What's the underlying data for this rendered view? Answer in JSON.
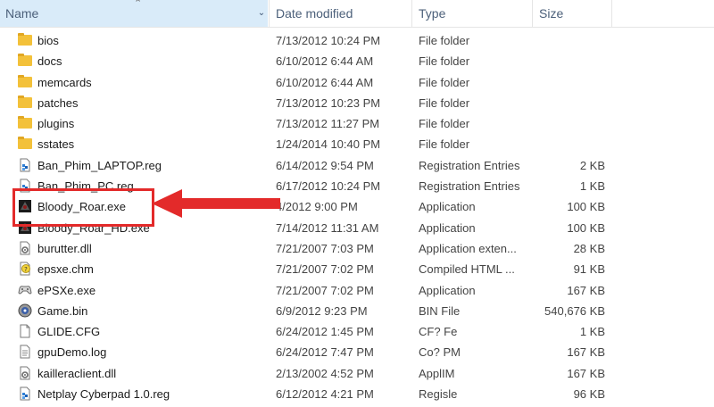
{
  "header": {
    "name": "Name",
    "date_modified": "Date modified",
    "type": "Type",
    "size": "Size"
  },
  "rows": [
    {
      "name": "bios",
      "date": "7/13/2012 10:24 PM",
      "type": "File folder",
      "size": "",
      "icon": "folder-icon"
    },
    {
      "name": "docs",
      "date": "6/10/2012 6:44 AM",
      "type": "File folder",
      "size": "",
      "icon": "folder-icon"
    },
    {
      "name": "memcards",
      "date": "6/10/2012 6:44 AM",
      "type": "File folder",
      "size": "",
      "icon": "folder-icon"
    },
    {
      "name": "patches",
      "date": "7/13/2012 10:23 PM",
      "type": "File folder",
      "size": "",
      "icon": "folder-icon"
    },
    {
      "name": "plugins",
      "date": "7/13/2012 11:27 PM",
      "type": "File folder",
      "size": "",
      "icon": "folder-icon"
    },
    {
      "name": "sstates",
      "date": "1/24/2014 10:40 PM",
      "type": "File folder",
      "size": "",
      "icon": "folder-icon"
    },
    {
      "name": "Ban_Phim_LAPTOP.reg",
      "date": "6/14/2012 9:54 PM",
      "type": "Registration Entries",
      "size": "2 KB",
      "icon": "registry-file-icon"
    },
    {
      "name": "Ban_Phim_PC.reg",
      "date": "6/17/2012 10:24 PM",
      "type": "Registration Entries",
      "size": "1 KB",
      "icon": "registry-file-icon"
    },
    {
      "name": "Bloody_Roar.exe",
      "date": "4/2012 9:00 PM",
      "type": "Application",
      "size": "100 KB",
      "icon": "game-exe-icon"
    },
    {
      "name": "Bloody_Roar_HD.exe",
      "date": "7/14/2012 11:31 AM",
      "type": "Application",
      "size": "100 KB",
      "icon": "game-exe-icon"
    },
    {
      "name": "burutter.dll",
      "date": "7/21/2007 7:03 PM",
      "type": "Application exten...",
      "size": "28 KB",
      "icon": "dll-gear-icon"
    },
    {
      "name": "epsxe.chm",
      "date": "7/21/2007 7:02 PM",
      "type": "Compiled HTML ...",
      "size": "91 KB",
      "icon": "help-file-icon"
    },
    {
      "name": "ePSXe.exe",
      "date": "7/21/2007 7:02 PM",
      "type": "Application",
      "size": "167 KB",
      "icon": "gamepad-exe-icon"
    },
    {
      "name": "Game.bin",
      "date": "6/9/2012 9:23 PM",
      "type": "BIN File",
      "size": "540,676 KB",
      "icon": "disc-file-icon"
    },
    {
      "name": "GLIDE.CFG",
      "date": "6/24/2012 1:45 PM",
      "type": "CF? Fe",
      "size": "1 KB",
      "icon": "blank-file-icon"
    },
    {
      "name": "gpuDemo.log",
      "date": "6/24/2012 7:47 PM",
      "type": "Co? PM",
      "size": "167 KB",
      "icon": "text-file-icon"
    },
    {
      "name": "kailleraclient.dll",
      "date": "2/13/2002 4:52 PM",
      "type": "ApplIM",
      "size": "167 KB",
      "icon": "dll-gear-icon"
    },
    {
      "name": "Netplay Cyberpad 1.0.reg",
      "date": "6/12/2012 4:21 PM",
      "type": "Regisle",
      "size": "96 KB",
      "icon": "registry-file-icon"
    }
  ],
  "annotation": {
    "color": "#e32a2a",
    "target_row": "Bloody_Roar.exe"
  }
}
